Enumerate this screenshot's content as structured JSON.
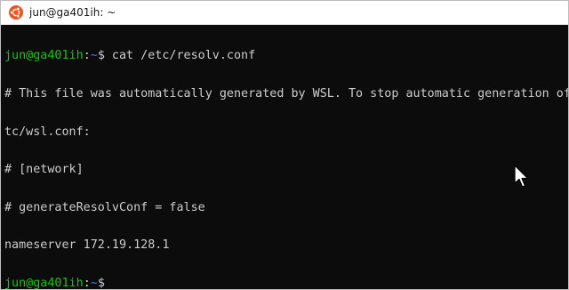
{
  "window": {
    "title": "jun@ga401ih: ~",
    "icon": "ubuntu-icon",
    "accent_color": "#e95420"
  },
  "terminal": {
    "background": "#0c0c0c",
    "lines": [
      {
        "type": "prompt",
        "user_host": "jun@ga401ih",
        "path": "~",
        "symbol": "$",
        "command": " cat /etc/resolv.conf"
      },
      {
        "type": "output",
        "text": "# This file was automatically generated by WSL. To stop automatic generation of this"
      },
      {
        "type": "output",
        "text": "tc/wsl.conf:"
      },
      {
        "type": "output",
        "text": "# [network]"
      },
      {
        "type": "output",
        "text": "# generateResolvConf = false"
      },
      {
        "type": "output",
        "text": "nameserver 172.19.128.1"
      },
      {
        "type": "prompt",
        "user_host": "jun@ga401ih",
        "path": "~",
        "symbol": "$",
        "command": ""
      }
    ]
  },
  "mouse_pointer": {
    "icon": "arrow-cursor-icon"
  }
}
